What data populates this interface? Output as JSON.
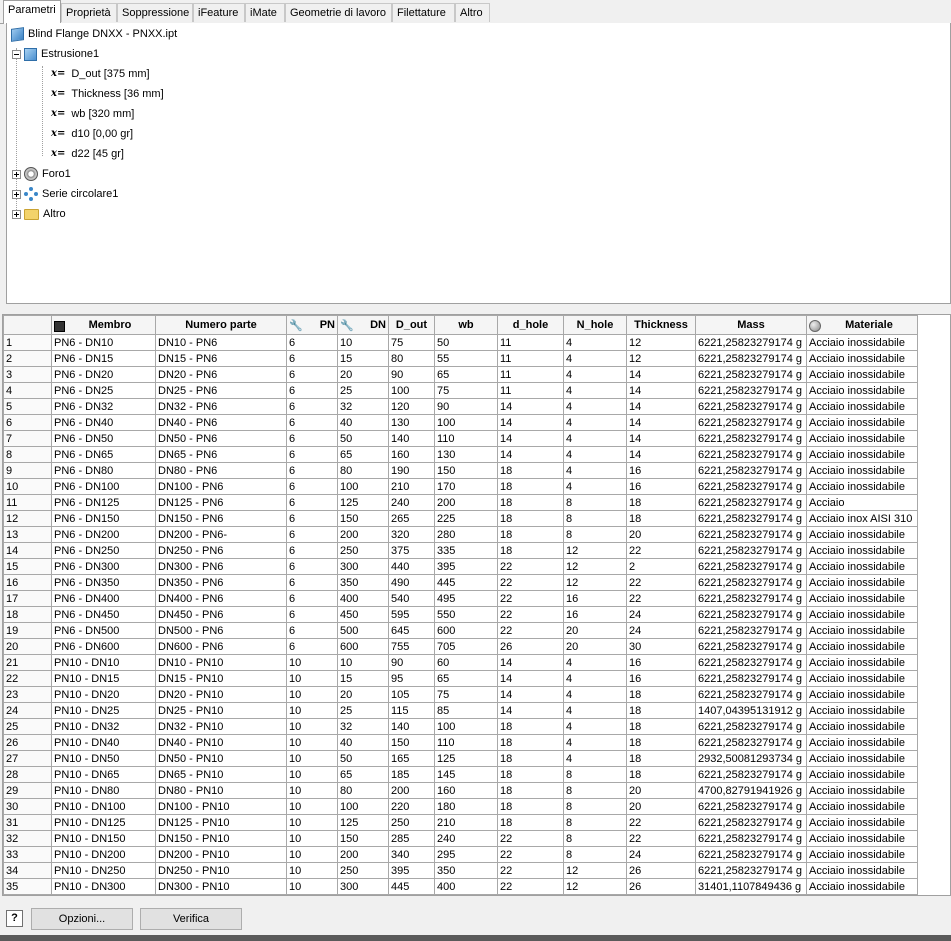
{
  "tabs": [
    "Parametri",
    "Proprietà",
    "Soppressione",
    "iFeature",
    "iMate",
    "Geometrie di lavoro",
    "Filettature",
    "Altro"
  ],
  "tree": {
    "root": "Blind Flange DNXX - PNXX.ipt",
    "extrusion": "Estrusione1",
    "params_prefix": "x=",
    "params": [
      "D_out [375 mm]",
      "Thickness [36 mm]",
      "wb [320 mm]",
      "d10 [0,00 gr]",
      "d22 [45 gr]"
    ],
    "hole": "Foro1",
    "pattern": "Serie circolare1",
    "other": "Altro"
  },
  "columns": [
    "Membro",
    "Numero parte",
    "PN",
    "DN",
    "D_out",
    "wb",
    "d_hole",
    "N_hole",
    "Thickness",
    "Mass",
    "Materiale"
  ],
  "rows": [
    [
      "1",
      "PN6 - DN10",
      "DN10 - PN6",
      "6",
      "10",
      "75",
      "50",
      "11",
      "4",
      "12",
      "6221,25823279174 g",
      "Acciaio inossidabile"
    ],
    [
      "2",
      "PN6 - DN15",
      "DN15 - PN6",
      "6",
      "15",
      "80",
      "55",
      "11",
      "4",
      "12",
      "6221,25823279174 g",
      "Acciaio inossidabile"
    ],
    [
      "3",
      "PN6 - DN20",
      "DN20 - PN6",
      "6",
      "20",
      "90",
      "65",
      "11",
      "4",
      "14",
      "6221,25823279174 g",
      "Acciaio inossidabile"
    ],
    [
      "4",
      "PN6 - DN25",
      "DN25 - PN6",
      "6",
      "25",
      "100",
      "75",
      "11",
      "4",
      "14",
      "6221,25823279174 g",
      "Acciaio inossidabile"
    ],
    [
      "5",
      "PN6 - DN32",
      "DN32 - PN6",
      "6",
      "32",
      "120",
      "90",
      "14",
      "4",
      "14",
      "6221,25823279174 g",
      "Acciaio inossidabile"
    ],
    [
      "6",
      "PN6 - DN40",
      "DN40 - PN6",
      "6",
      "40",
      "130",
      "100",
      "14",
      "4",
      "14",
      "6221,25823279174 g",
      "Acciaio inossidabile"
    ],
    [
      "7",
      "PN6 - DN50",
      "DN50 - PN6",
      "6",
      "50",
      "140",
      "110",
      "14",
      "4",
      "14",
      "6221,25823279174 g",
      "Acciaio inossidabile"
    ],
    [
      "8",
      "PN6 - DN65",
      "DN65 - PN6",
      "6",
      "65",
      "160",
      "130",
      "14",
      "4",
      "14",
      "6221,25823279174 g",
      "Acciaio inossidabile"
    ],
    [
      "9",
      "PN6 - DN80",
      "DN80 - PN6",
      "6",
      "80",
      "190",
      "150",
      "18",
      "4",
      "16",
      "6221,25823279174 g",
      "Acciaio inossidabile"
    ],
    [
      "10",
      "PN6 - DN100",
      "DN100 - PN6",
      "6",
      "100",
      "210",
      "170",
      "18",
      "4",
      "16",
      "6221,25823279174 g",
      "Acciaio inossidabile"
    ],
    [
      "11",
      "PN6 - DN125",
      "DN125 - PN6",
      "6",
      "125",
      "240",
      "200",
      "18",
      "8",
      "18",
      "6221,25823279174 g",
      "Acciaio"
    ],
    [
      "12",
      "PN6 - DN150",
      "DN150 - PN6",
      "6",
      "150",
      "265",
      "225",
      "18",
      "8",
      "18",
      "6221,25823279174 g",
      "Acciaio inox AISI 310"
    ],
    [
      "13",
      "PN6 - DN200",
      "DN200 - PN6-",
      "6",
      "200",
      "320",
      "280",
      "18",
      "8",
      "20",
      "6221,25823279174 g",
      "Acciaio inossidabile"
    ],
    [
      "14",
      "PN6 - DN250",
      "DN250 - PN6",
      "6",
      "250",
      "375",
      "335",
      "18",
      "12",
      "22",
      "6221,25823279174 g",
      "Acciaio inossidabile"
    ],
    [
      "15",
      "PN6 - DN300",
      "DN300 - PN6",
      "6",
      "300",
      "440",
      "395",
      "22",
      "12",
      "2",
      "6221,25823279174 g",
      "Acciaio inossidabile"
    ],
    [
      "16",
      "PN6 - DN350",
      "DN350 - PN6",
      "6",
      "350",
      "490",
      "445",
      "22",
      "12",
      "22",
      "6221,25823279174 g",
      "Acciaio inossidabile"
    ],
    [
      "17",
      "PN6 - DN400",
      "DN400 - PN6",
      "6",
      "400",
      "540",
      "495",
      "22",
      "16",
      "22",
      "6221,25823279174 g",
      "Acciaio inossidabile"
    ],
    [
      "18",
      "PN6 - DN450",
      "DN450 - PN6",
      "6",
      "450",
      "595",
      "550",
      "22",
      "16",
      "24",
      "6221,25823279174 g",
      "Acciaio inossidabile"
    ],
    [
      "19",
      "PN6 - DN500",
      "DN500 - PN6",
      "6",
      "500",
      "645",
      "600",
      "22",
      "20",
      "24",
      "6221,25823279174 g",
      "Acciaio inossidabile"
    ],
    [
      "20",
      "PN6 - DN600",
      "DN600 - PN6",
      "6",
      "600",
      "755",
      "705",
      "26",
      "20",
      "30",
      "6221,25823279174 g",
      "Acciaio inossidabile"
    ],
    [
      "21",
      "PN10 - DN10",
      "DN10 - PN10",
      "10",
      "10",
      "90",
      "60",
      "14",
      "4",
      "16",
      "6221,25823279174 g",
      "Acciaio inossidabile"
    ],
    [
      "22",
      "PN10 - DN15",
      "DN15 - PN10",
      "10",
      "15",
      "95",
      "65",
      "14",
      "4",
      "16",
      "6221,25823279174 g",
      "Acciaio inossidabile"
    ],
    [
      "23",
      "PN10 - DN20",
      "DN20 - PN10",
      "10",
      "20",
      "105",
      "75",
      "14",
      "4",
      "18",
      "6221,25823279174 g",
      "Acciaio inossidabile"
    ],
    [
      "24",
      "PN10 - DN25",
      "DN25 - PN10",
      "10",
      "25",
      "115",
      "85",
      "14",
      "4",
      "18",
      "1407,04395131912 g",
      "Acciaio inossidabile"
    ],
    [
      "25",
      "PN10 - DN32",
      "DN32 - PN10",
      "10",
      "32",
      "140",
      "100",
      "18",
      "4",
      "18",
      "6221,25823279174 g",
      "Acciaio inossidabile"
    ],
    [
      "26",
      "PN10 - DN40",
      "DN40 - PN10",
      "10",
      "40",
      "150",
      "110",
      "18",
      "4",
      "18",
      "6221,25823279174 g",
      "Acciaio inossidabile"
    ],
    [
      "27",
      "PN10 - DN50",
      "DN50 - PN10",
      "10",
      "50",
      "165",
      "125",
      "18",
      "4",
      "18",
      "2932,50081293734 g",
      "Acciaio inossidabile"
    ],
    [
      "28",
      "PN10 - DN65",
      "DN65 - PN10",
      "10",
      "65",
      "185",
      "145",
      "18",
      "8",
      "18",
      "6221,25823279174 g",
      "Acciaio inossidabile"
    ],
    [
      "29",
      "PN10 - DN80",
      "DN80 - PN10",
      "10",
      "80",
      "200",
      "160",
      "18",
      "8",
      "20",
      "4700,82791941926 g",
      "Acciaio inossidabile"
    ],
    [
      "30",
      "PN10 - DN100",
      "DN100 - PN10",
      "10",
      "100",
      "220",
      "180",
      "18",
      "8",
      "20",
      "6221,25823279174 g",
      "Acciaio inossidabile"
    ],
    [
      "31",
      "PN10 - DN125",
      "DN125 - PN10",
      "10",
      "125",
      "250",
      "210",
      "18",
      "8",
      "22",
      "6221,25823279174 g",
      "Acciaio inossidabile"
    ],
    [
      "32",
      "PN10 - DN150",
      "DN150 - PN10",
      "10",
      "150",
      "285",
      "240",
      "22",
      "8",
      "22",
      "6221,25823279174 g",
      "Acciaio inossidabile"
    ],
    [
      "33",
      "PN10 - DN200",
      "DN200 - PN10",
      "10",
      "200",
      "340",
      "295",
      "22",
      "8",
      "24",
      "6221,25823279174 g",
      "Acciaio inossidabile"
    ],
    [
      "34",
      "PN10 - DN250",
      "DN250 - PN10",
      "10",
      "250",
      "395",
      "350",
      "22",
      "12",
      "26",
      "6221,25823279174 g",
      "Acciaio inossidabile"
    ],
    [
      "35",
      "PN10 - DN300",
      "DN300 - PN10",
      "10",
      "300",
      "445",
      "400",
      "22",
      "12",
      "26",
      "31401,1107849436 g",
      "Acciaio inossidabile"
    ]
  ],
  "buttons": {
    "help": "?",
    "options": "Opzioni...",
    "verify": "Verifica"
  }
}
